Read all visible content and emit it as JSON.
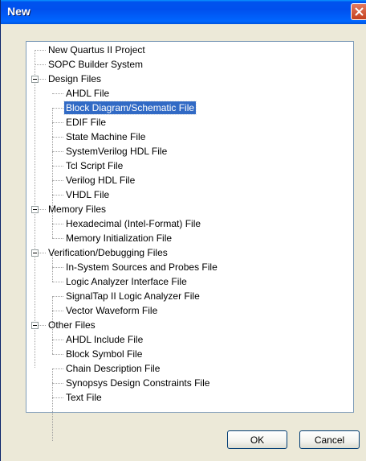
{
  "window": {
    "title": "New"
  },
  "tree": {
    "nodes": [
      {
        "label": "New Quartus II Project"
      },
      {
        "label": "SOPC Builder System"
      },
      {
        "label": "Design Files",
        "expanded": true
      },
      {
        "label": "AHDL File"
      },
      {
        "label": "Block Diagram/Schematic File",
        "selected": true
      },
      {
        "label": "EDIF File"
      },
      {
        "label": "State Machine File"
      },
      {
        "label": "SystemVerilog HDL File"
      },
      {
        "label": "Tcl Script File"
      },
      {
        "label": "Verilog HDL File"
      },
      {
        "label": "VHDL File"
      },
      {
        "label": "Memory Files",
        "expanded": true
      },
      {
        "label": "Hexadecimal (Intel-Format) File"
      },
      {
        "label": "Memory Initialization File"
      },
      {
        "label": "Verification/Debugging Files",
        "expanded": true
      },
      {
        "label": "In-System Sources and Probes File"
      },
      {
        "label": "Logic Analyzer Interface File"
      },
      {
        "label": "SignalTap II Logic Analyzer File"
      },
      {
        "label": "Vector Waveform File"
      },
      {
        "label": "Other Files",
        "expanded": true
      },
      {
        "label": "AHDL Include File"
      },
      {
        "label": "Block Symbol File"
      },
      {
        "label": "Chain Description File"
      },
      {
        "label": "Synopsys Design Constraints File"
      },
      {
        "label": "Text File"
      }
    ]
  },
  "buttons": {
    "ok": "OK",
    "cancel": "Cancel"
  }
}
